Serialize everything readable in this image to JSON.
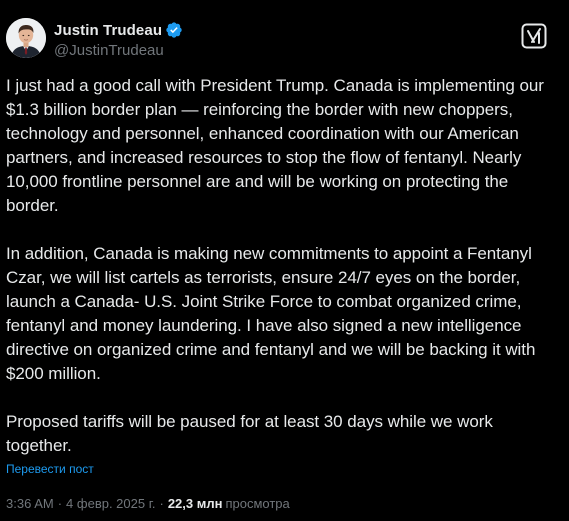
{
  "author": {
    "display_name": "Justin Trudeau",
    "handle": "@JustinTrudeau",
    "verified_color": "#1d9bf0"
  },
  "header": {
    "grok_icon": "grok-icon"
  },
  "post": {
    "text": "I just had a good call with President Trump. Canada is implementing our $1.3 billion border plan — reinforcing the border with new choppers, technology and personnel, enhanced coordination with our American partners, and increased resources to stop the flow of fentanyl. Nearly 10,000 frontline personnel are and will be working on protecting the border.\n\nIn addition, Canada is making new commitments to appoint a Fentanyl Czar, we will list cartels as terrorists, ensure 24/7 eyes on the border, launch a Canada- U.S. Joint Strike Force to combat organized crime, fentanyl and money laundering. I have also signed a new intelligence directive on organized crime and fentanyl and we will be backing it with $200 million.\n\nProposed tariffs will be paused for at least 30 days while we work together.",
    "translate_label": "Перевести пост"
  },
  "meta": {
    "time": "3:36 AM",
    "separator": "·",
    "date": "4 февр. 2025 г.",
    "views_count": "22,3 млн",
    "views_label": "просмотра"
  },
  "colors": {
    "background": "#000000",
    "text": "#e7e9ea",
    "secondary": "#71767b",
    "link": "#1d9bf0"
  }
}
